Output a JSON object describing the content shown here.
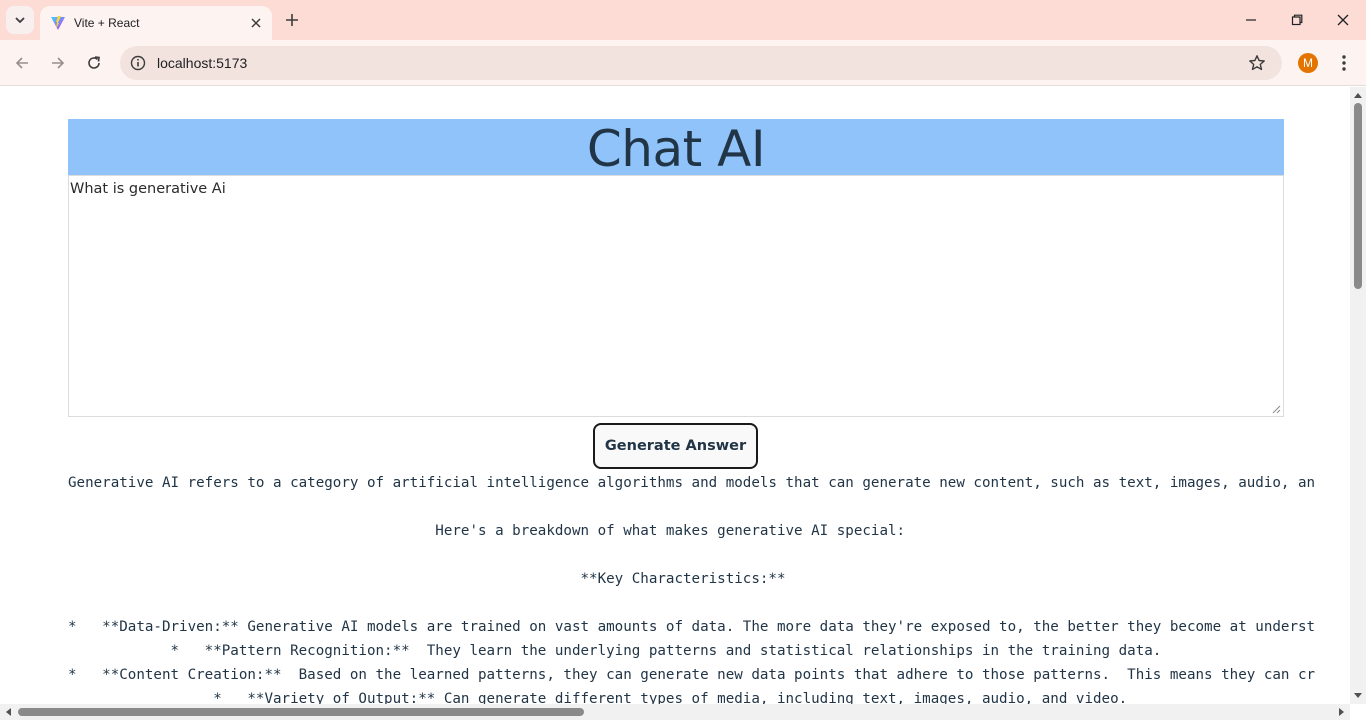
{
  "browser": {
    "tab_title": "Vite + React",
    "url": "localhost:5173",
    "profile_initial": "M",
    "accent_color": "#e37400"
  },
  "page": {
    "title": "Chat AI",
    "header_color": "#90c3fa",
    "question_value": "What is generative Ai",
    "generate_button_label": "Generate Answer",
    "answer_lines": [
      "Generative AI refers to a category of artificial intelligence algorithms and models that can generate new content, such as text, images, audio, an",
      "",
      "                                           Here's a breakdown of what makes generative AI special:",
      "",
      "                                                            **Key Characteristics:**",
      "",
      "*   **Data-Driven:** Generative AI models are trained on vast amounts of data. The more data they're exposed to, the better they become at underst",
      "            *   **Pattern Recognition:**  They learn the underlying patterns and statistical relationships in the training data.",
      "*   **Content Creation:**  Based on the learned patterns, they can generate new data points that adhere to those patterns.  This means they can cr",
      "                 *   **Variety of Output:** Can generate different types of media, including text, images, audio, and video."
    ]
  }
}
